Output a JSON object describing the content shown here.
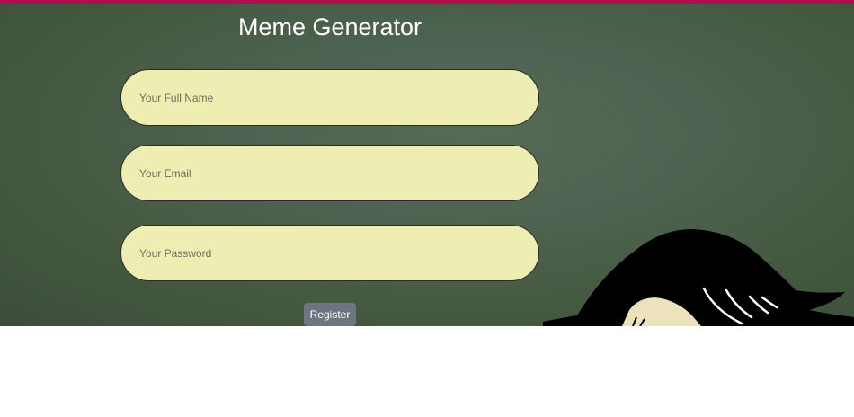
{
  "app": {
    "title": "Meme Generator"
  },
  "form": {
    "full_name_placeholder": "Your Full Name",
    "email_placeholder": "Your Email",
    "password_placeholder": "Your Password",
    "register_label": "Register"
  },
  "colors": {
    "top_bar": "#b0104a",
    "background": "#4d6250",
    "field_fill": "#eeeeb3",
    "button": "#6c7580"
  },
  "decor": {
    "illustration": "cartoon-character-head"
  }
}
